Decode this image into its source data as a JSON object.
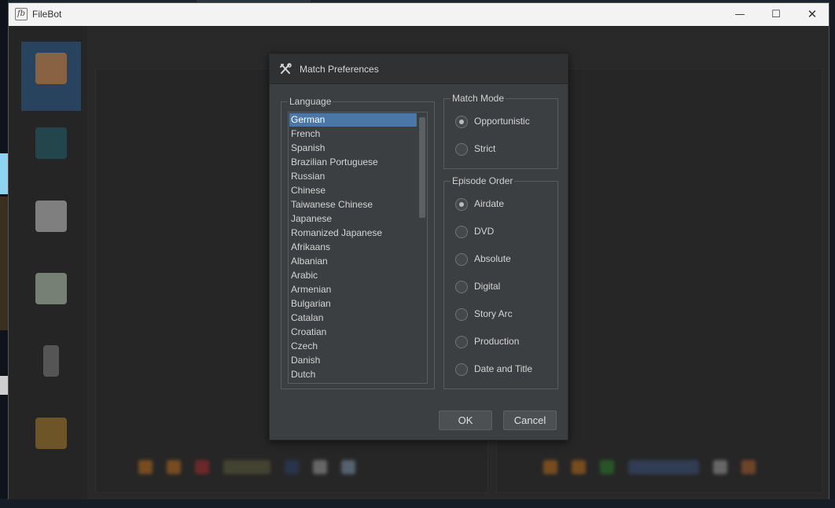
{
  "window": {
    "title": "FileBot",
    "controls": {
      "minimize": "—",
      "maximize": "☐",
      "close": "✕"
    }
  },
  "dialog": {
    "title": "Match Preferences",
    "language_group": {
      "legend": "Language",
      "selected": "German",
      "items": [
        "German",
        "French",
        "Spanish",
        "Brazilian Portuguese",
        "Russian",
        "Chinese",
        "Taiwanese Chinese",
        "Japanese",
        "Romanized Japanese",
        "Afrikaans",
        "Albanian",
        "Arabic",
        "Armenian",
        "Bulgarian",
        "Catalan",
        "Croatian",
        "Czech",
        "Danish",
        "Dutch"
      ]
    },
    "match_mode": {
      "legend": "Match Mode",
      "options": [
        "Opportunistic",
        "Strict"
      ],
      "selected": "Opportunistic"
    },
    "episode_order": {
      "legend": "Episode Order",
      "options": [
        "Airdate",
        "DVD",
        "Absolute",
        "Digital",
        "Story Arc",
        "Production",
        "Date and Title"
      ],
      "selected": "Airdate"
    },
    "buttons": {
      "ok": "OK",
      "cancel": "Cancel"
    }
  },
  "colors": {
    "accent": "#4a77a6",
    "dialog_bg": "#3c3f41",
    "titlebar_bg": "#f3f3f3"
  }
}
